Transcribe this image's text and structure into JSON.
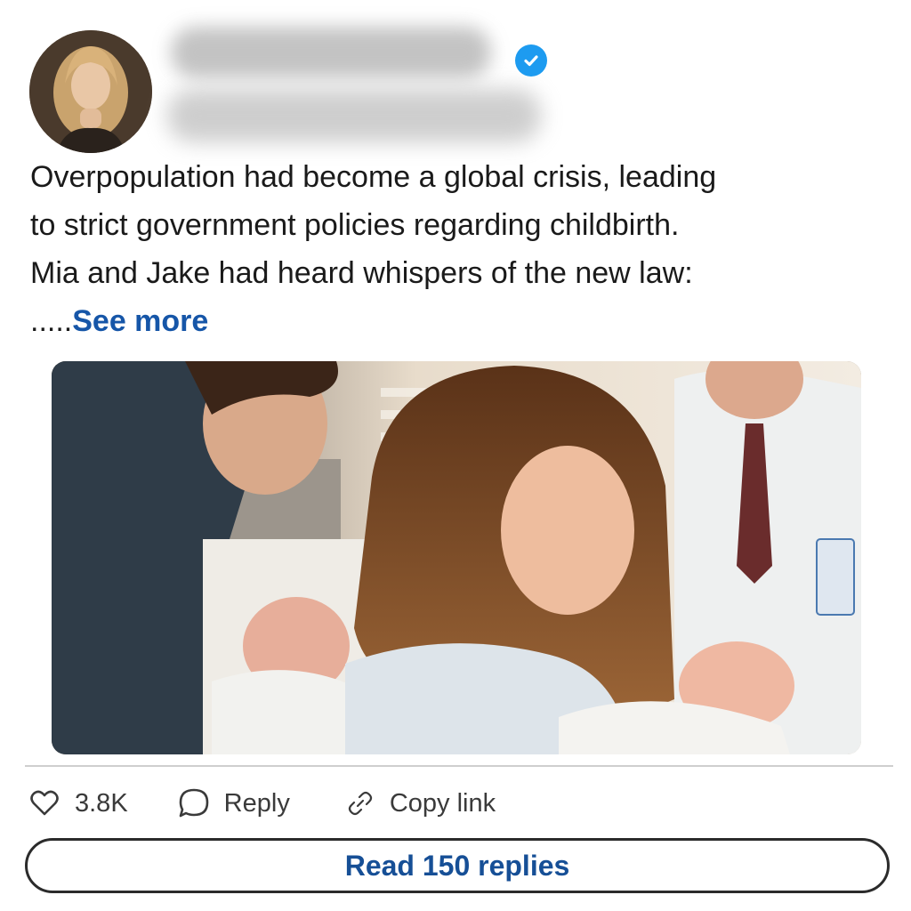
{
  "post": {
    "author_verified": true,
    "text_lines": [
      "Overpopulation had become a global crisis, leading",
      "to strict government policies regarding childbirth.",
      "Mia and Jake had heard whispers of the new law:"
    ],
    "see_more_prefix": ".....",
    "see_more_label": "See more"
  },
  "actions": {
    "likes_count": "3.8K",
    "reply_label": "Reply",
    "copy_link_label": "Copy link"
  },
  "read_replies_label": "Read 150 replies",
  "colors": {
    "link_blue": "#1656a8",
    "verified_blue": "#1d9bf0",
    "button_text": "#164f96"
  }
}
